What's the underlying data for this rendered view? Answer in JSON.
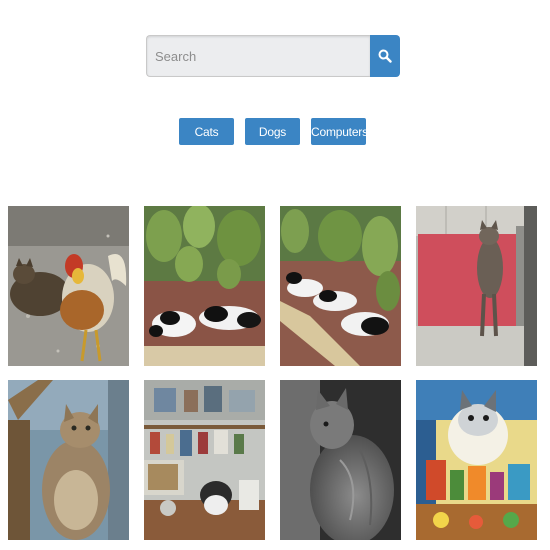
{
  "search": {
    "placeholder": "Search",
    "button_icon": "search-icon"
  },
  "categories": [
    {
      "label": "Cats"
    },
    {
      "label": "Dogs"
    },
    {
      "label": "Computers"
    }
  ],
  "colors": {
    "accent": "#3b85c4",
    "input_bg": "#ecedef"
  }
}
